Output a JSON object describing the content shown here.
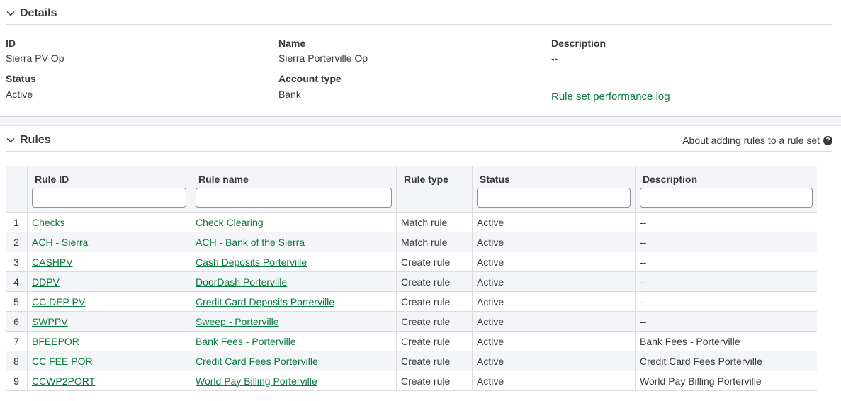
{
  "details": {
    "title": "Details",
    "id_label": "ID",
    "id_value": "Sierra PV Op",
    "name_label": "Name",
    "name_value": "Sierra Porterville Op",
    "description_label": "Description",
    "description_value": "--",
    "status_label": "Status",
    "status_value": "Active",
    "account_type_label": "Account type",
    "account_type_value": "Bank",
    "perf_log_link": "Rule set performance log"
  },
  "rules": {
    "title": "Rules",
    "about_link": "About adding rules to a rule set",
    "columns": {
      "rule_id": "Rule ID",
      "rule_name": "Rule name",
      "rule_type": "Rule type",
      "status": "Status",
      "description": "Description"
    },
    "rows": [
      {
        "num": "1",
        "rule_id": "Checks",
        "rule_name": "Check Clearing",
        "rule_type": "Match rule",
        "status": "Active",
        "description": "--"
      },
      {
        "num": "2",
        "rule_id": "ACH - Sierra",
        "rule_name": "ACH - Bank of the Sierra",
        "rule_type": "Match rule",
        "status": "Active",
        "description": "--"
      },
      {
        "num": "3",
        "rule_id": "CASHPV",
        "rule_name": "Cash Deposits Porterville",
        "rule_type": "Create rule",
        "status": "Active",
        "description": "--"
      },
      {
        "num": "4",
        "rule_id": "DDPV",
        "rule_name": "DoorDash Porterville",
        "rule_type": "Create rule",
        "status": "Active",
        "description": "--"
      },
      {
        "num": "5",
        "rule_id": "CC DEP PV",
        "rule_name": "Credit Card Deposits Porterville",
        "rule_type": "Create rule",
        "status": "Active",
        "description": "--"
      },
      {
        "num": "6",
        "rule_id": "SWPPV",
        "rule_name": "Sweep - Porterville",
        "rule_type": "Create rule",
        "status": "Active",
        "description": "--"
      },
      {
        "num": "7",
        "rule_id": "BFEEPOR",
        "rule_name": "Bank Fees - Porterville",
        "rule_type": "Create rule",
        "status": "Active",
        "description": "Bank Fees - Porterville"
      },
      {
        "num": "8",
        "rule_id": "CC FEE POR",
        "rule_name": "Credit Card Fees Porterville",
        "rule_type": "Create rule",
        "status": "Active",
        "description": "Credit Card Fees Porterville"
      },
      {
        "num": "9",
        "rule_id": "CCWP2PORT",
        "rule_name": "World Pay Billing Porterville",
        "rule_type": "Create rule",
        "status": "Active",
        "description": "World Pay Billing Porterville"
      }
    ]
  },
  "icons": {
    "collapse": "chevron-down-icon",
    "help": "help-circle-icon"
  },
  "colors": {
    "link": "#0b7a3e",
    "text": "#393a3d",
    "header_bg": "#f4f5f8"
  }
}
